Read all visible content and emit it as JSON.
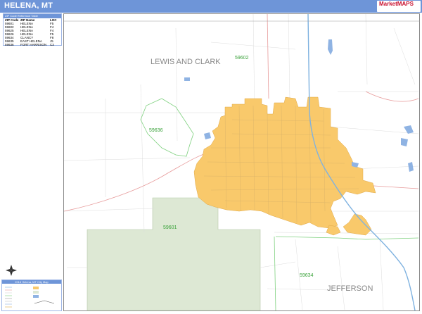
{
  "title": "HELENA, MT",
  "logo": {
    "text": "MarketMAPS"
  },
  "zip_table": {
    "header": "ZIP Code Reference Table",
    "columns": [
      "ZIP Code",
      "ZIP Name",
      "LOC"
    ],
    "rows": [
      {
        "zip": "59601",
        "name": "HELENA",
        "loc": "F5"
      },
      {
        "zip": "59602",
        "name": "HELENA",
        "loc": "F4"
      },
      {
        "zip": "59625",
        "name": "HELENA",
        "loc": "F4"
      },
      {
        "zip": "59626",
        "name": "HELENA",
        "loc": "F5"
      },
      {
        "zip": "59634",
        "name": "CLANCY",
        "loc": "F8"
      },
      {
        "zip": "59635",
        "name": "EAST HELENA",
        "loc": "J5"
      },
      {
        "zip": "59636",
        "name": "FORT HARRISON",
        "loc": "C3"
      }
    ]
  },
  "map": {
    "county_labels": [
      "LEWIS AND CLARK",
      "JEFFERSON"
    ],
    "zip_labels": [
      "59602",
      "59636",
      "59601",
      "59634"
    ],
    "colors": {
      "city": "#f9c96b",
      "forest": "#dde8d4",
      "zip_line": "#7fd17f",
      "road": "#d7d7d7",
      "highway": "#e79a9a",
      "interstate": "#7fb2e0",
      "water": "#8fb3e3"
    }
  },
  "legend": {
    "title": "2016 Helena, MT City Map"
  }
}
